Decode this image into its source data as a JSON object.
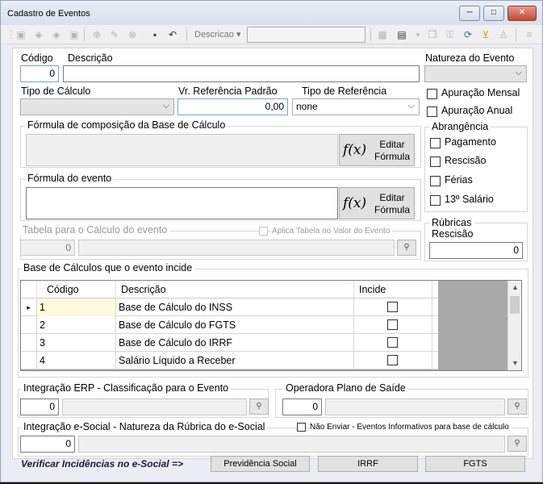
{
  "window": {
    "title": "Cadastro de Eventos",
    "min_label": "─",
    "max_label": "□",
    "close_label": "✕"
  },
  "toolbar": {
    "descricao_label": "Descricao",
    "descricao_arrow": "▾",
    "descricao_value": ""
  },
  "evento": {
    "codigo_label": "Código",
    "codigo_value": "0",
    "descricao_label": "Descrição",
    "descricao_value": "",
    "natureza_label": "Natureza do Evento",
    "natureza_value": "",
    "tipo_calculo_label": "Tipo de Cálculo",
    "tipo_calculo_value": "",
    "vr_ref_label": "Vr. Referência Padrão",
    "vr_ref_value": "0,00",
    "tipo_ref_label": "Tipo de Referência",
    "tipo_ref_value": "none",
    "apuracao_mensal_label": "Apuração Mensal",
    "apuracao_anual_label": "Apuração Anual"
  },
  "formula_base": {
    "title": "Fórmula de composição da Base de Cálculo",
    "value": "",
    "button_fx": "f(x)",
    "button_line1": "Editar",
    "button_line2": "Fórmula"
  },
  "formula_evento": {
    "title": "Fórmula do evento",
    "value": "",
    "button_fx": "f(x)",
    "button_line1": "Editar",
    "button_line2": "Fórmula"
  },
  "abrangencia": {
    "title": "Abrangência",
    "items": [
      "Pagamento",
      "Rescisão",
      "Férias",
      "13º Salário"
    ]
  },
  "tabela": {
    "title": "Tabela para o Cálculo do evento",
    "aplica_label": "Aplica Tabela no Valor do Evento",
    "codigo_value": "0",
    "desc_value": ""
  },
  "rubricas": {
    "label_line1": "Rúbricas",
    "label_line2": "Rescisão",
    "value": "0"
  },
  "bases": {
    "title": "Base de Cálculos que o evento incide",
    "columns": [
      "Código",
      "Descrição",
      "Incide"
    ],
    "rows": [
      {
        "codigo": "1",
        "descricao": "Base de Cálculo do INSS",
        "incide": false
      },
      {
        "codigo": "2",
        "descricao": "Base de Cálculo do FGTS",
        "incide": false
      },
      {
        "codigo": "3",
        "descricao": "Base de Cálculo do IRRF",
        "incide": false
      },
      {
        "codigo": "4",
        "descricao": "Salário Líquido a Receber",
        "incide": false
      }
    ],
    "current_marker": "▸"
  },
  "integracao_erp": {
    "title": "Integração ERP - Classificação para o Evento",
    "value": "0",
    "desc": ""
  },
  "operadora": {
    "title": "Operadora Plano de Saíde",
    "value": "0",
    "desc": ""
  },
  "esocial": {
    "title": "Integração e-Social - Natureza da Rúbrica do e-Social",
    "nao_enviar_label": "Não Enviar - Eventos Informativos para base de cálculo",
    "value": "0",
    "desc": ""
  },
  "footer": {
    "verificar_label": "Verificar Incidências no e-Social =>",
    "buttons": [
      "Previdência Social",
      "IRRF",
      "FGTS"
    ]
  }
}
